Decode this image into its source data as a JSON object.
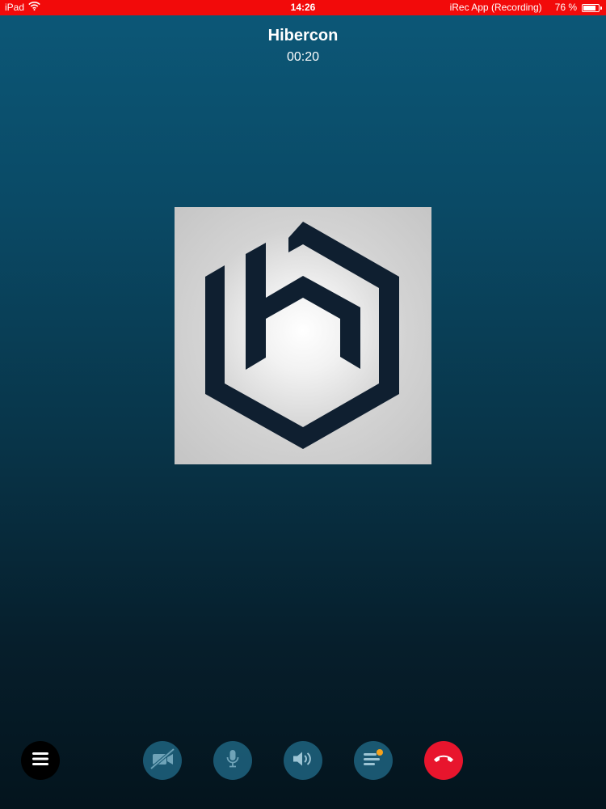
{
  "status_bar": {
    "device": "iPad",
    "time": "14:26",
    "recording_label": "iRec App (Recording)",
    "battery_text": "76 %",
    "battery_level": 0.76,
    "background_color": "#f20a0a"
  },
  "call": {
    "contact_name": "Hibercon",
    "duration": "00:20"
  },
  "avatar": {
    "logo_icon": "hibercon-logo",
    "logo_color": "#0f1f30"
  },
  "controls": {
    "menu_icon": "hamburger-menu-icon",
    "video_icon": "video-off-icon",
    "mic_icon": "microphone-icon",
    "speaker_icon": "speaker-icon",
    "chat_icon": "chat-list-icon",
    "chat_badge_color": "#f7a21b",
    "end_call_icon": "hang-up-icon",
    "end_call_color": "#e8152d"
  }
}
